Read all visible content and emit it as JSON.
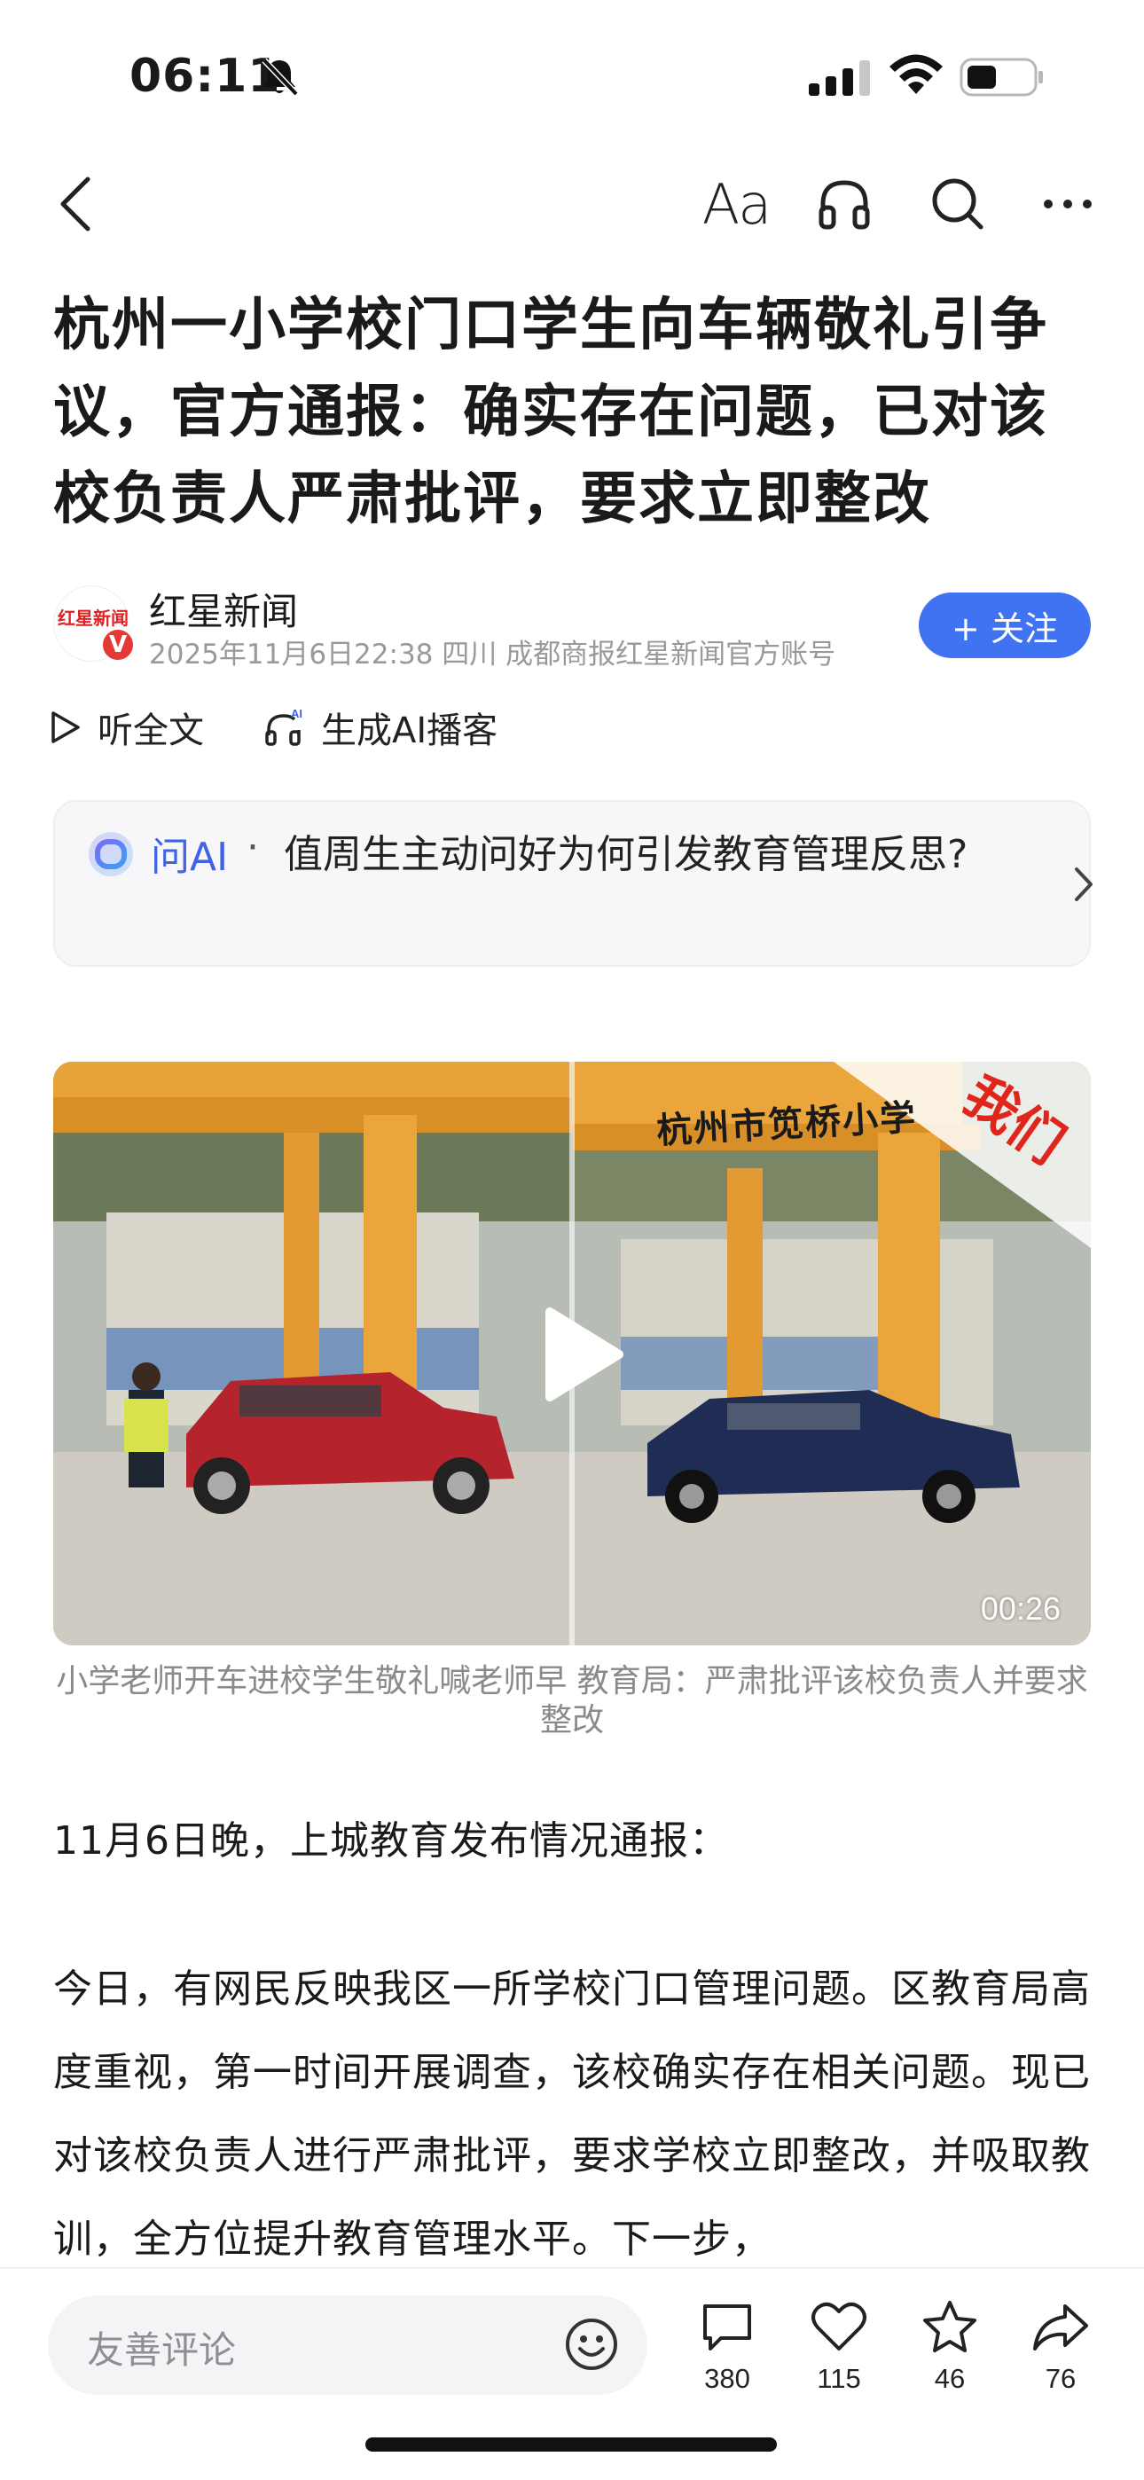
{
  "status_bar": {
    "time": "06:11",
    "icons": [
      "bell-slash-icon",
      "signal-icon",
      "wifi-icon",
      "battery-icon"
    ]
  },
  "nav": {
    "font_size_label": "Aa",
    "icons": [
      "back-chevron-icon",
      "font-size-icon",
      "headphones-icon",
      "search-icon",
      "more-icon"
    ]
  },
  "article": {
    "title": "杭州一小学校门口学生向车辆敬礼引争议，官方通报：确实存在问题，已对该校负责人严肃批评，要求立即整改",
    "author": {
      "name": "红星新闻",
      "meta": "2025年11月6日22:38 四川 成都商报红星新闻官方账号",
      "avatar_logo_text": "红星新闻",
      "verified_badge": "V",
      "follow_label": "+ 关注"
    },
    "actions": {
      "listen_label": "听全文",
      "ai_podcast_label": "生成AI播客",
      "ai_badge": "AI"
    },
    "ask_ai": {
      "label": "问AI",
      "separator": "·",
      "question": "值周生主动问好为何引发教育管理反思?"
    },
    "video": {
      "duration": "00:26",
      "watermark": "我们",
      "school_sign": "杭州市笕桥小学",
      "caption": "小学老师开车进校学生敬礼喊老师早 教育局：严肃批评该校负责人并要求整改"
    },
    "paragraphs": [
      "11月6日晚，上城教育发布情况通报：",
      "今日，有网民反映我区一所学校门口管理问题。区教育局高度重视，第一时间开展调查，该校确实存在相关问题。现已对该校负责人进行严肃批评，要求学校立即整改，并吸取教训，全方位提升教育管理水平。下一步，"
    ]
  },
  "bottom_bar": {
    "comment_placeholder": "友善评论",
    "comments": "380",
    "likes": "115",
    "favorites": "46",
    "shares": "76"
  },
  "colors": {
    "accent_blue": "#3f73f2",
    "ai_blue": "#3f62e6",
    "brand_red": "#e53935"
  }
}
